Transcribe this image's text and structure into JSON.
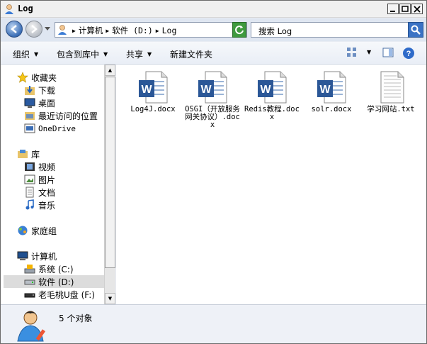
{
  "window": {
    "title": "Log"
  },
  "address": {
    "crumbs": [
      "计算机",
      "软件 (D:)",
      "Log"
    ]
  },
  "search": {
    "placeholder": "搜索 Log"
  },
  "toolbar": {
    "organize": "组织",
    "include_in_library": "包含到库中",
    "share": "共享",
    "new_folder": "新建文件夹"
  },
  "nav": {
    "favorites": {
      "label": "收藏夹",
      "items": [
        "下载",
        "桌面",
        "最近访问的位置",
        "OneDrive"
      ]
    },
    "libraries": {
      "label": "库",
      "items": [
        "视频",
        "图片",
        "文档",
        "音乐"
      ]
    },
    "homegroup": "家庭组",
    "computer": {
      "label": "计算机",
      "items": [
        "系统 (C:)",
        "软件 (D:)",
        "老毛桃U盘 (F:)"
      ]
    }
  },
  "files": [
    {
      "name": "Log4J.docx",
      "type": "word"
    },
    {
      "name": "OSGI（开放服务网关协议）.docx",
      "type": "word"
    },
    {
      "name": "Redis教程.docx",
      "type": "word"
    },
    {
      "name": "solr.docx",
      "type": "word"
    },
    {
      "name": "学习网站.txt",
      "type": "txt"
    }
  ],
  "status": {
    "count_text": "5 个对象"
  },
  "colors": {
    "word_blue": "#2b5797",
    "selection_gray": "#dcdcdc",
    "nav_bg": "#dfe6f1"
  },
  "icons": [
    "user-icon",
    "back-arrow-icon",
    "forward-arrow-icon",
    "refresh-icon",
    "search-icon",
    "view-icon",
    "preview-pane-icon",
    "help-icon",
    "star-icon",
    "folder-icon",
    "computer-icon",
    "drive-icon",
    "homegroup-icon",
    "word-doc-icon",
    "text-file-icon"
  ]
}
